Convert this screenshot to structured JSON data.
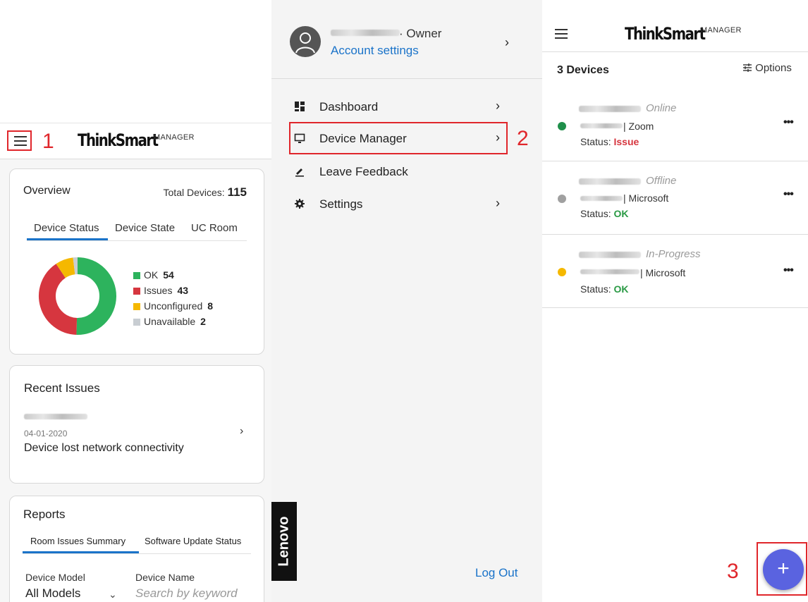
{
  "annotations": {
    "one": "1",
    "two": "2",
    "three": "3"
  },
  "brand": {
    "name": "ThinkSmart",
    "suffix": "MANAGER"
  },
  "dashboard": {
    "overview": {
      "title": "Overview",
      "total_label": "Total Devices:",
      "total_value": "115",
      "tabs": [
        "Device Status",
        "Device State",
        "UC Room"
      ],
      "active_tab": "Device Status"
    },
    "chart_data": {
      "type": "pie",
      "categories": [
        "OK",
        "Issues",
        "Unconfigured",
        "Unavailable"
      ],
      "values": [
        54,
        43,
        8,
        2
      ],
      "colors": [
        "#2db35d",
        "#d6363f",
        "#f5b800",
        "#c8cdd2"
      ],
      "donut": true
    },
    "recent_issues": {
      "title": "Recent Issues",
      "date": "04-01-2020",
      "description": "Device lost network connectivity"
    },
    "reports": {
      "title": "Reports",
      "tabs": [
        "Room Issues Summary",
        "Software Update Status"
      ],
      "active_tab": "Room Issues Summary",
      "model_label": "Device Model",
      "model_value": "All Models",
      "name_label": "Device Name",
      "name_placeholder": "Search by keyword"
    }
  },
  "drawer": {
    "role": "· Owner",
    "account_settings": "Account settings",
    "items": [
      {
        "label": "Dashboard",
        "icon": "dashboard-icon",
        "chevron": true
      },
      {
        "label": "Device Manager",
        "icon": "monitor-icon",
        "chevron": true
      },
      {
        "label": "Leave Feedback",
        "icon": "pencil-icon",
        "chevron": false
      },
      {
        "label": "Settings",
        "icon": "gear-icon",
        "chevron": true
      }
    ],
    "logo": "Lenovo",
    "logout": "Log Out"
  },
  "devices_page": {
    "count_label": "3 Devices",
    "options_label": "Options",
    "devices": [
      {
        "state": "Online",
        "uc": "| Zoom",
        "status_label": "Status:",
        "status": "Issue",
        "status_color": "#d6363f",
        "dot_color": "#1f8f4a"
      },
      {
        "state": "Offline",
        "uc": "| Microsoft",
        "status_label": "Status:",
        "status": "OK",
        "status_color": "#2a9a45",
        "dot_color": "#a0a0a0"
      },
      {
        "state": "In-Progress",
        "uc": "| Microsoft",
        "status_label": "Status:",
        "status": "OK",
        "status_color": "#2a9a45",
        "dot_color": "#f5b800"
      }
    ],
    "fab_label": "+",
    "more_label": "•••"
  }
}
